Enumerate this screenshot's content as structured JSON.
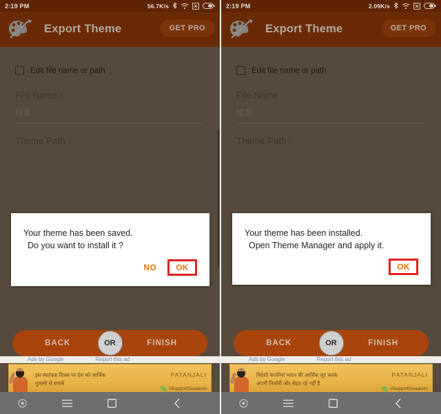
{
  "panels": [
    {
      "id": "left",
      "statusbar": {
        "time": "2:19 PM",
        "network_speed": "56.7K/s",
        "icons": [
          "bluetooth-icon",
          "wifi-icon",
          "no-sim-icon",
          "battery-icon"
        ]
      },
      "appbar": {
        "logo_icon": "palette-icon",
        "title": "Export Theme",
        "get_pro_label": "GET PRO"
      },
      "form": {
        "checkbox_label": "Edit file name or path",
        "checkbox_checked": false,
        "file_name_label": "File Name :",
        "file_name_value": "炫黑",
        "theme_path_label": "Theme Path :"
      },
      "dialog": {
        "line1": "Your theme has been saved.",
        "line2": "Do you want to install it ?",
        "buttons": [
          {
            "label": "NO",
            "highlighted": false
          },
          {
            "label": "OK",
            "highlighted": true
          }
        ]
      },
      "actionbar": {
        "back_label": "BACK",
        "or_label": "OR",
        "finish_label": "FINISH"
      },
      "ad": {
        "ads_by_label": "Ads by Google",
        "report_label": "Report this ad",
        "headline_line1": "इस स्वतंत्रता दिवस पर देश को आर्थिक",
        "headline_line2": "गुलामी से बचायें",
        "brand": "PATANJALI",
        "hashtag": "#SupportSwadeshi"
      },
      "navbar": {
        "icons": [
          "screen-record-icon",
          "menu-icon",
          "home-icon",
          "back-icon"
        ]
      }
    },
    {
      "id": "right",
      "statusbar": {
        "time": "2:19 PM",
        "network_speed": "2.09K/s",
        "icons": [
          "bluetooth-icon",
          "wifi-icon",
          "no-sim-icon",
          "battery-icon"
        ]
      },
      "appbar": {
        "logo_icon": "palette-icon",
        "title": "Export Theme",
        "get_pro_label": "GET PRO"
      },
      "form": {
        "checkbox_label": "Edit file name or path",
        "checkbox_checked": false,
        "file_name_label": "File Name :",
        "file_name_value": "炫黑",
        "theme_path_label": "Theme Path :"
      },
      "dialog": {
        "line1": "Your theme has been installed.",
        "line2": "Open Theme Manager and apply it.",
        "buttons": [
          {
            "label": "OK",
            "highlighted": true
          }
        ]
      },
      "actionbar": {
        "back_label": "BACK",
        "or_label": "OR",
        "finish_label": "FINISH"
      },
      "ad": {
        "ads_by_label": "Ads by Google",
        "report_label": "Report this ad",
        "headline_line1": "विदेशी कंपनियां भारत की आर्थिक लूट करके",
        "headline_line2": "अपनी तिजोरी और सेहत रहे नहीं है",
        "brand": "PATANJALI",
        "hashtag": "#SupportSwadeshi"
      },
      "navbar": {
        "icons": [
          "screen-record-icon",
          "menu-icon",
          "home-icon",
          "back-icon"
        ]
      }
    }
  ],
  "colors": {
    "status_bar": "#5e2304",
    "app_bar": "#6b2a06",
    "accent_orange": "#e8760f",
    "highlight_red": "#e02020",
    "action_bar": "#a8440c",
    "dim_background": "#6b5c4c"
  }
}
